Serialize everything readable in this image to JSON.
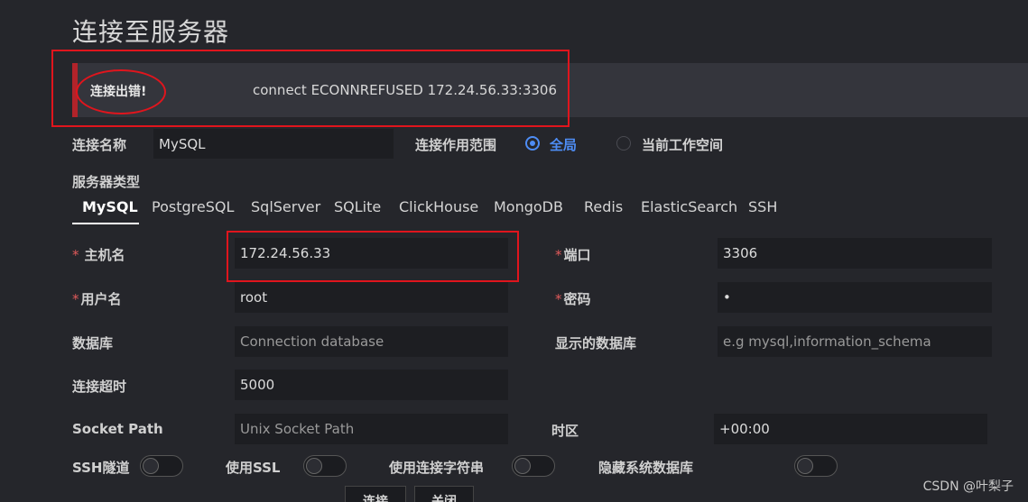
{
  "title": "连接至服务器",
  "error": {
    "title": "连接出错!",
    "message": "connect ECONNREFUSED 172.24.56.33:3306"
  },
  "connection_name": {
    "label": "连接名称",
    "value": "MySQL"
  },
  "scope": {
    "label": "连接作用范围",
    "options": [
      "全局",
      "当前工作空间"
    ],
    "selected": "全局",
    "accent": "#4e8df5"
  },
  "server_type": {
    "label": "服务器类型",
    "tabs": [
      "MySQL",
      "PostgreSQL",
      "SqlServer",
      "SQLite",
      "ClickHouse",
      "MongoDB",
      "Redis",
      "ElasticSearch",
      "SSH"
    ],
    "active": "MySQL"
  },
  "fields": {
    "host": {
      "label": "主机名",
      "required": true,
      "value": "172.24.56.33"
    },
    "port": {
      "label": "端口",
      "required": true,
      "value": "3306"
    },
    "username": {
      "label": "用户名",
      "required": true,
      "value": "root"
    },
    "password": {
      "label": "密码",
      "required": true,
      "value": "•"
    },
    "database": {
      "label": "数据库",
      "placeholder": "Connection database"
    },
    "show_databases": {
      "label": "显示的数据库",
      "placeholder": "e.g mysql,information_schema"
    },
    "timeout": {
      "label": "连接超时",
      "value": "5000"
    },
    "socket_path": {
      "label": "Socket Path",
      "placeholder": "Unix Socket Path"
    },
    "timezone": {
      "label": "时区",
      "value": "+00:00"
    }
  },
  "toggles": {
    "ssh_tunnel": {
      "label": "SSH隧道",
      "on": false
    },
    "use_ssl": {
      "label": "使用SSL",
      "on": false
    },
    "use_connection_string": {
      "label": "使用连接字符串",
      "on": false
    },
    "hide_system_db": {
      "label": "隐藏系统数据库",
      "on": false
    }
  },
  "buttons": {
    "connect": "连接",
    "close": "关闭"
  },
  "watermark": "CSDN @叶梨子",
  "colors": {
    "error_accent": "#b2232a",
    "annotation": "#e0151d"
  }
}
